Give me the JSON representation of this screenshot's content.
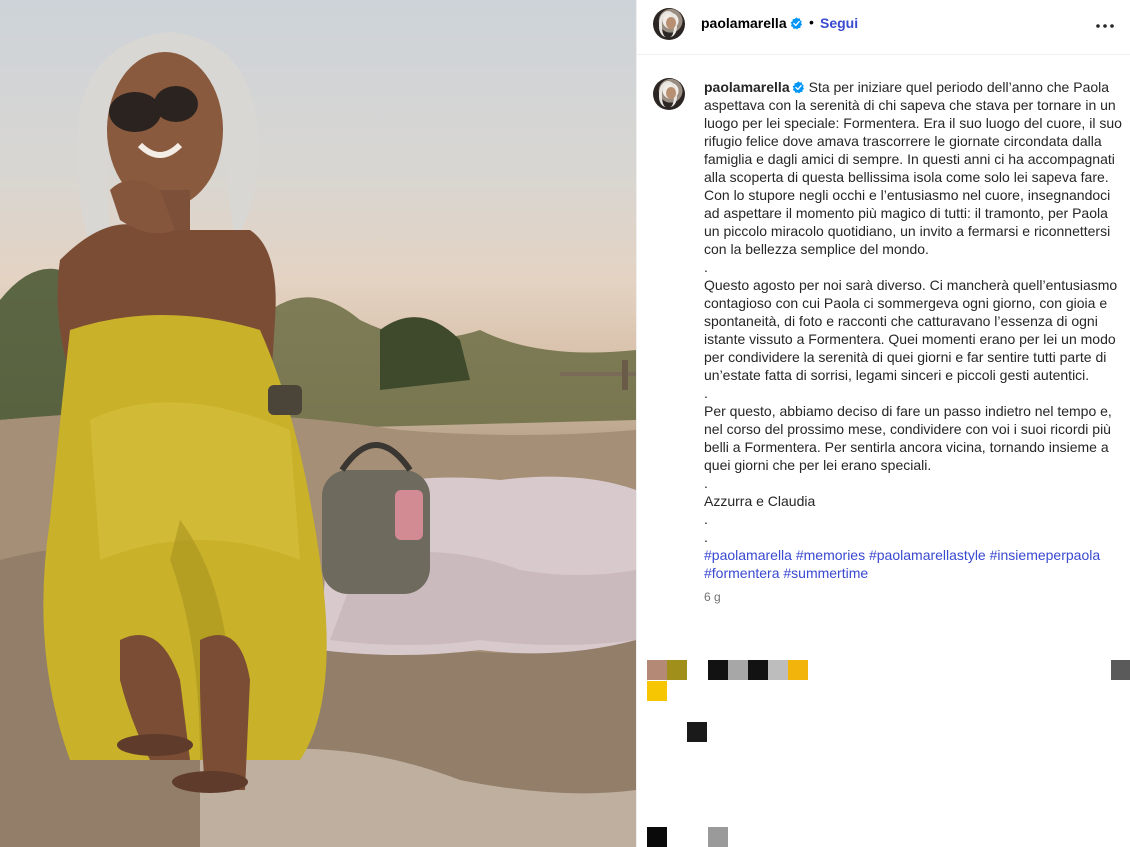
{
  "post": {
    "username": "paolamarella",
    "follow_label": "Segui",
    "separator": "•",
    "caption_paragraphs": [
      "Sta per iniziare quel periodo dell’anno che Paola aspettava con la serenità di chi sapeva che stava per tornare in un luogo per lei speciale: Formentera. Era il suo luogo del cuore, il suo rifugio felice dove amava trascorrere le giornate circondata dalla famiglia e dagli amici di sempre. In questi anni ci ha accompagnati alla scoperta di questa bellissima isola come solo lei sapeva fare. Con lo stupore negli occhi e l’entusiasmo nel cuore, insegnandoci ad aspettare il momento più magico di tutti: il tramonto, per Paola un piccolo miracolo quotidiano, un invito a fermarsi e riconnettersi con la bellezza semplice del mondo.",
      ".",
      "Questo agosto per noi sarà diverso. Ci mancherà quell’entusiasmo contagioso con cui Paola ci sommergeva ogni giorno, con gioia e spontaneità, di foto e racconti che catturavano l’essenza di ogni istante vissuto a Formentera. Quei momenti erano per lei un modo per condividere la serenità di quei giorni e far sentire tutti parte di un’estate fatta di sorrisi, legami sinceri e piccoli gesti autentici.",
      ".",
      "Per questo, abbiamo deciso di fare un passo indietro nel tempo e, nel corso del prossimo mese, condividere con voi i suoi ricordi più belli a Formentera. Per sentirla ancora vicina, tornando insieme a quei giorni che per lei erano speciali.",
      ".",
      "Azzurra e Claudia",
      ".",
      "."
    ],
    "hashtags": [
      "#paolamarella",
      "#memories",
      "#paolamarellastyle",
      "#insiemeperpaola",
      "#formentera",
      "#summertime"
    ],
    "time_ago": "6 g"
  },
  "colors": {
    "link": "#3949d1",
    "verified": "#0095f6",
    "dress": "#c9b12a"
  },
  "icons": {
    "verified": "verified-badge-icon",
    "more": "more-options-icon"
  }
}
